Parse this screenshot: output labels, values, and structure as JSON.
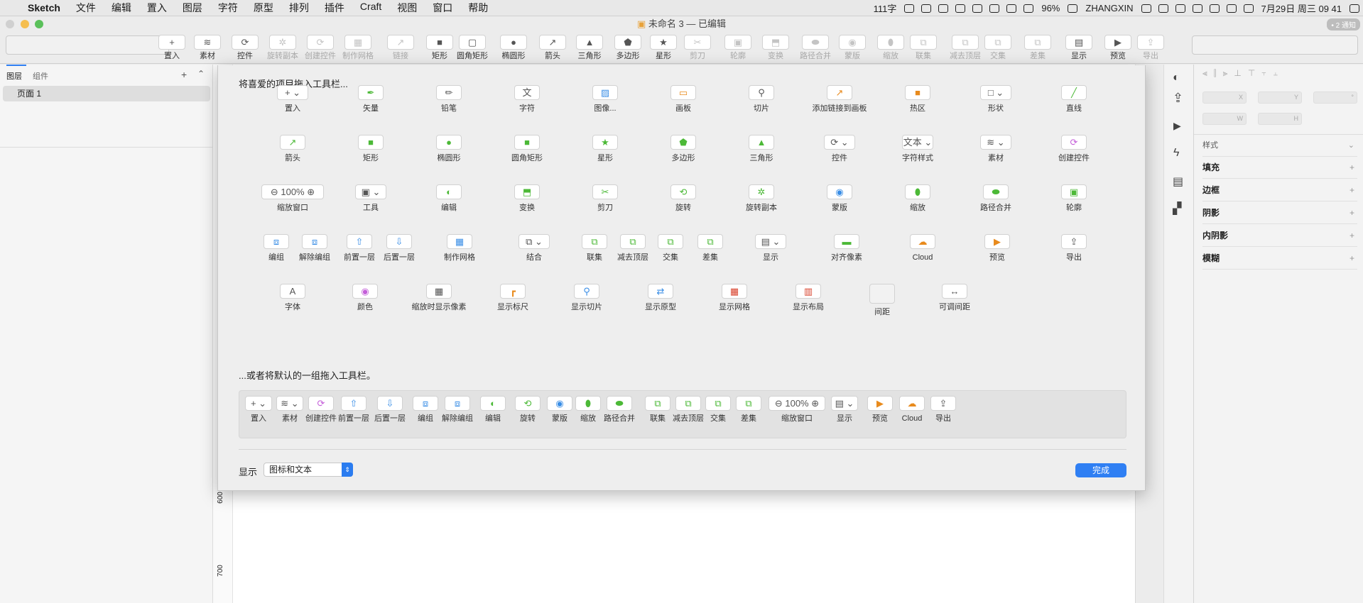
{
  "menubar": {
    "app": "Sketch",
    "menus": [
      "文件",
      "编辑",
      "置入",
      "图层",
      "字符",
      "原型",
      "排列",
      "插件",
      "Craft",
      "视图",
      "窗口",
      "帮助"
    ],
    "wordcount": "111字",
    "battery": "96%",
    "user": "ZHANGXIN",
    "datetime": "7月29日 周三 09 41"
  },
  "window": {
    "title": "未命名 3 — 已编辑",
    "badge": "• 2 通知"
  },
  "toolbar": {
    "items": [
      {
        "icon": "plus-icon",
        "label": "置入",
        "dis": false,
        "sym": "+"
      },
      {
        "icon": "layers-icon",
        "label": "素材",
        "dis": false,
        "sym": "≋"
      },
      {
        "icon": "symbol-icon",
        "label": "控件",
        "dis": false,
        "sym": "⟳"
      },
      {
        "icon": "rotate-copy-icon",
        "label": "旋转副本",
        "dis": true,
        "sym": "✲"
      },
      {
        "icon": "create-symbol-icon",
        "label": "创建控件",
        "dis": true,
        "sym": "⟳"
      },
      {
        "icon": "grid-icon",
        "label": "制作网格",
        "dis": true,
        "sym": "▦"
      },
      {
        "icon": "link-icon",
        "label": "链接",
        "dis": true,
        "sym": "↗"
      },
      {
        "icon": "rect-icon",
        "label": "矩形",
        "dis": false,
        "sym": "■"
      },
      {
        "icon": "rounded-rect-icon",
        "label": "圆角矩形",
        "dis": false,
        "sym": "▢"
      },
      {
        "icon": "oval-icon",
        "label": "椭圆形",
        "dis": false,
        "sym": "●"
      },
      {
        "icon": "arrow-icon",
        "label": "箭头",
        "dis": false,
        "sym": "↗"
      },
      {
        "icon": "triangle-icon",
        "label": "三角形",
        "dis": false,
        "sym": "▲"
      },
      {
        "icon": "polygon-icon",
        "label": "多边形",
        "dis": false,
        "sym": "⬟"
      },
      {
        "icon": "star-icon",
        "label": "星形",
        "dis": false,
        "sym": "★"
      },
      {
        "icon": "scissors-icon",
        "label": "剪刀",
        "dis": true,
        "sym": "✂"
      },
      {
        "icon": "outline-icon",
        "label": "轮廓",
        "dis": true,
        "sym": "▣"
      },
      {
        "icon": "transform-icon",
        "label": "变换",
        "dis": true,
        "sym": "⬒"
      },
      {
        "icon": "flatten-icon",
        "label": "路径合并",
        "dis": true,
        "sym": "⬬"
      },
      {
        "icon": "mask-icon",
        "label": "蒙版",
        "dis": true,
        "sym": "◉"
      },
      {
        "icon": "scale-icon",
        "label": "缩放",
        "dis": true,
        "sym": "⬮"
      },
      {
        "icon": "union-icon",
        "label": "联集",
        "dis": true,
        "sym": "⧉"
      },
      {
        "icon": "subtract-icon",
        "label": "减去顶层",
        "dis": true,
        "sym": "⧉"
      },
      {
        "icon": "intersect-icon",
        "label": "交集",
        "dis": true,
        "sym": "⧉"
      },
      {
        "icon": "difference-icon",
        "label": "差集",
        "dis": true,
        "sym": "⧉"
      },
      {
        "icon": "view-icon",
        "label": "显示",
        "dis": false,
        "sym": "▤"
      },
      {
        "icon": "preview-icon",
        "label": "预览",
        "dis": false,
        "sym": "▶"
      },
      {
        "icon": "export-icon",
        "label": "导出",
        "dis": true,
        "sym": "⇪"
      }
    ]
  },
  "leftpanel": {
    "tabs": [
      "图层",
      "组件"
    ],
    "page": "页面 1"
  },
  "ruler": [
    "600",
    "700"
  ],
  "inspector": {
    "fields": [
      "X",
      "Y",
      "°",
      "W",
      "H"
    ],
    "sections": [
      "样式",
      "填充",
      "边框",
      "阴影",
      "内阴影",
      "模糊"
    ]
  },
  "sheet": {
    "heading1": "将喜爱的项目拖入工具栏...",
    "rows": [
      [
        {
          "icon": "insert-icon",
          "label": "置入",
          "sym": "+ ⌄",
          "w": 44
        },
        {
          "icon": "vector-icon",
          "label": "矢量",
          "sym": "✒",
          "c": "g"
        },
        {
          "icon": "pencil-icon",
          "label": "铅笔",
          "sym": "✏"
        },
        {
          "icon": "text-icon",
          "label": "字符",
          "sym": "文"
        },
        {
          "icon": "image-icon",
          "label": "图像...",
          "sym": "▨",
          "c": "b"
        },
        {
          "icon": "artboard-icon",
          "label": "画板",
          "sym": "▭",
          "c": "o"
        },
        {
          "icon": "slice-icon",
          "label": "切片",
          "sym": "⚲"
        },
        {
          "icon": "link-artboard-icon",
          "label": "添加链接到画板",
          "sym": "↗",
          "c": "o"
        },
        {
          "icon": "hotspot-icon",
          "label": "热区",
          "sym": "■",
          "c": "o"
        },
        {
          "icon": "shape-icon",
          "label": "形状",
          "sym": "□ ⌄",
          "w": 44
        },
        {
          "icon": "line-icon",
          "label": "直线",
          "sym": "╱",
          "c": "g"
        }
      ],
      [
        {
          "icon": "arrow-icon",
          "label": "箭头",
          "sym": "↗",
          "c": "g"
        },
        {
          "icon": "rect-icon",
          "label": "矩形",
          "sym": "■",
          "c": "g"
        },
        {
          "icon": "oval-icon",
          "label": "椭圆形",
          "sym": "●",
          "c": "g"
        },
        {
          "icon": "rounded-rect-icon",
          "label": "圆角矩形",
          "sym": "■",
          "c": "g"
        },
        {
          "icon": "star-icon",
          "label": "星形",
          "sym": "★",
          "c": "g"
        },
        {
          "icon": "polygon-icon",
          "label": "多边形",
          "sym": "⬟",
          "c": "g"
        },
        {
          "icon": "triangle-icon",
          "label": "三角形",
          "sym": "▲",
          "c": "g"
        },
        {
          "icon": "symbols-icon",
          "label": "控件",
          "sym": "⟳ ⌄",
          "w": 44
        },
        {
          "icon": "text-style-icon",
          "label": "字符样式",
          "sym": "文本 ⌄",
          "w": 44
        },
        {
          "icon": "assets-icon",
          "label": "素材",
          "sym": "≋ ⌄",
          "w": 44
        },
        {
          "icon": "create-symbol-icon",
          "label": "创建控件",
          "sym": "⟳",
          "c": "p"
        }
      ],
      [
        {
          "icon": "zoom-icon",
          "label": "缩放窗口",
          "sym": "⊖  100%  ⊕",
          "w": 88
        },
        {
          "icon": "tools-icon",
          "label": "工具",
          "sym": "▣ ⌄",
          "w": 44
        },
        {
          "icon": "edit-icon",
          "label": "编辑",
          "sym": "◐",
          "c": "g"
        },
        {
          "icon": "transform-icon",
          "label": "变换",
          "sym": "⬒",
          "c": "g"
        },
        {
          "icon": "scissors-icon",
          "label": "剪刀",
          "sym": "✂",
          "c": "g"
        },
        {
          "icon": "rotate-icon",
          "label": "旋转",
          "sym": "⟲",
          "c": "g"
        },
        {
          "icon": "rotate-copy-icon",
          "label": "旋转副本",
          "sym": "✲",
          "c": "g"
        },
        {
          "icon": "mask-icon",
          "label": "蒙版",
          "sym": "◉",
          "c": "b"
        },
        {
          "icon": "scale-icon",
          "label": "缩放",
          "sym": "⬮",
          "c": "g"
        },
        {
          "icon": "flatten-icon",
          "label": "路径合并",
          "sym": "⬬",
          "c": "g"
        },
        {
          "icon": "outline-icon",
          "label": "轮廓",
          "sym": "▣",
          "c": "g"
        }
      ],
      [
        {
          "icon": "group-icon",
          "label": "编组",
          "sym": "⧈",
          "c": "b"
        },
        {
          "icon": "ungroup-icon",
          "label": "解除编组",
          "sym": "⧈",
          "c": "b"
        },
        {
          "icon": "forward-icon",
          "label": "前置一层",
          "sym": "⇧",
          "c": "b"
        },
        {
          "icon": "backward-icon",
          "label": "后置一层",
          "sym": "⇩",
          "c": "b"
        },
        {
          "icon": "grid-icon",
          "label": "制作网格",
          "sym": "▦",
          "c": "b"
        },
        {
          "icon": "combine-icon",
          "label": "结合",
          "sym": "⧉ ⌄",
          "w": 44
        },
        {
          "icon": "union-icon",
          "label": "联集",
          "sym": "⧉",
          "c": "g"
        },
        {
          "icon": "subtract-icon",
          "label": "减去顶层",
          "sym": "⧉",
          "c": "g"
        },
        {
          "icon": "intersect-icon",
          "label": "交集",
          "sym": "⧉",
          "c": "g"
        },
        {
          "icon": "difference-icon",
          "label": "差集",
          "sym": "⧉",
          "c": "g"
        },
        {
          "icon": "view-icon",
          "label": "显示",
          "sym": "▤ ⌄",
          "w": 44
        },
        {
          "icon": "pixel-align-icon",
          "label": "对齐像素",
          "sym": "▬",
          "c": "g"
        },
        {
          "icon": "cloud-icon",
          "label": "Cloud",
          "sym": "☁",
          "c": "o"
        },
        {
          "icon": "preview-icon",
          "label": "预览",
          "sym": "▶",
          "c": "o"
        },
        {
          "icon": "export-icon",
          "label": "导出",
          "sym": "⇪"
        }
      ],
      [
        {
          "icon": "font-icon",
          "label": "字体",
          "sym": "A"
        },
        {
          "icon": "color-icon",
          "label": "颜色",
          "sym": "◉",
          "c": "p"
        },
        {
          "icon": "pixels-icon",
          "label": "缩放时显示像素",
          "sym": "▦"
        },
        {
          "icon": "rulers-icon",
          "label": "显示标尺",
          "sym": "┏",
          "c": "o"
        },
        {
          "icon": "show-slices-icon",
          "label": "显示切片",
          "sym": "⚲",
          "c": "b"
        },
        {
          "icon": "show-prototype-icon",
          "label": "显示原型",
          "sym": "⇄",
          "c": "b"
        },
        {
          "icon": "show-grid-icon",
          "label": "显示网格",
          "sym": "▦",
          "c": "r"
        },
        {
          "icon": "show-layout-icon",
          "label": "显示布局",
          "sym": "▥",
          "c": "r"
        },
        {
          "icon": "space-icon",
          "label": "间距",
          "sym": " "
        },
        {
          "icon": "flex-space-icon",
          "label": "可调间距",
          "sym": "↔"
        }
      ]
    ],
    "heading2": "...或者将默认的一组拖入工具栏。",
    "defaults": [
      {
        "icon": "insert-icon",
        "label": "置入",
        "sym": "+ ⌄",
        "w": 38
      },
      {
        "icon": "assets-icon",
        "label": "素材",
        "sym": "≋ ⌄",
        "w": 38
      },
      {
        "icon": "create-symbol-icon",
        "label": "创建控件",
        "sym": "⟳",
        "c": "p"
      },
      {
        "icon": "forward-icon",
        "label": "前置一层",
        "sym": "⇧",
        "c": "b"
      },
      {
        "icon": "backward-icon",
        "label": "后置一层",
        "sym": "⇩",
        "c": "b"
      },
      {
        "icon": "group-icon",
        "label": "编组",
        "sym": "⧈",
        "c": "b"
      },
      {
        "icon": "ungroup-icon",
        "label": "解除编组",
        "sym": "⧈",
        "c": "b"
      },
      {
        "icon": "edit-icon",
        "label": "编辑",
        "sym": "◐",
        "c": "g"
      },
      {
        "icon": "rotate-icon",
        "label": "旋转",
        "sym": "⟲",
        "c": "g"
      },
      {
        "icon": "mask-icon",
        "label": "蒙版",
        "sym": "◉",
        "c": "b"
      },
      {
        "icon": "scale-icon",
        "label": "缩放",
        "sym": "⬮",
        "c": "g"
      },
      {
        "icon": "flatten-icon",
        "label": "路径合并",
        "sym": "⬬",
        "c": "g"
      },
      {
        "icon": "union-icon",
        "label": "联集",
        "sym": "⧉",
        "c": "g"
      },
      {
        "icon": "subtract-icon",
        "label": "减去顶层",
        "sym": "⧉",
        "c": "g"
      },
      {
        "icon": "intersect-icon",
        "label": "交集",
        "sym": "⧉",
        "c": "g"
      },
      {
        "icon": "difference-icon",
        "label": "差集",
        "sym": "⧉",
        "c": "g"
      },
      {
        "icon": "zoom-icon",
        "label": "缩放窗口",
        "sym": "⊖ 100% ⊕",
        "w": 80
      },
      {
        "icon": "view-icon",
        "label": "显示",
        "sym": "▤ ⌄",
        "w": 38
      },
      {
        "icon": "preview-icon",
        "label": "预览",
        "sym": "▶",
        "c": "o"
      },
      {
        "icon": "cloud-icon",
        "label": "Cloud",
        "sym": "☁",
        "c": "o"
      },
      {
        "icon": "export-icon",
        "label": "导出",
        "sym": "⇪"
      }
    ],
    "show_label": "显示",
    "show_value": "图标和文本",
    "done": "完成"
  }
}
